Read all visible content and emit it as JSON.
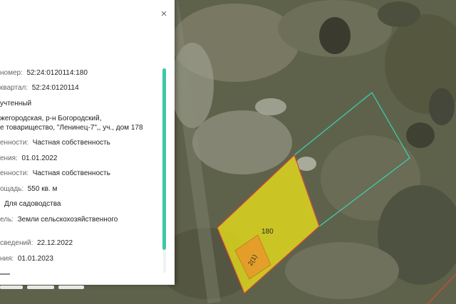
{
  "panel": {
    "close_glyph": "×",
    "rows": [
      {
        "label": "номер:",
        "value": "52:24:0120114:180"
      },
      {
        "label": "квартал:",
        "value": "52:24:0120114"
      },
      {
        "label": "",
        "value": "учтенный"
      },
      {
        "label": "",
        "value": "жегородская, р-н Богородский,"
      },
      {
        "label": "",
        "value": "е товарищество, \"Ленинец-7\",, уч., дом 178"
      },
      {
        "label": "енности:",
        "value": "Частная собственность"
      },
      {
        "label": "ения:",
        "value": "01.01.2022"
      },
      {
        "label": "енности:",
        "value": "Частная собственность"
      },
      {
        "label": "ощадь:",
        "value": "550 кв. м"
      },
      {
        "label": "",
        "value": "Для садоводства"
      },
      {
        "label": "ель:",
        "value": "Земли сельскохозяйственного"
      },
      {
        "label": "сведений:",
        "value": "22.12.2022"
      },
      {
        "label": "ния:",
        "value": "01.01.2023"
      }
    ]
  },
  "map": {
    "parcel_number": "180",
    "building_number": "2(1)",
    "parcel_fill": "#e8e21a",
    "parcel_border": "#d9453a",
    "neighbor_border": "#39d4b0",
    "accent": "#3cc9a8"
  }
}
